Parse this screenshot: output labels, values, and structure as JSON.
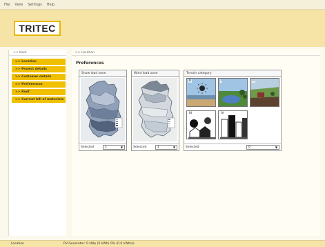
{
  "menu": {
    "items": [
      "File",
      "View",
      "Settings",
      "Help"
    ]
  },
  "brand": {
    "logo_text": "TRITEC",
    "accent": "#f0c000"
  },
  "sidebar": {
    "back_label": "<< back",
    "items": [
      {
        "label": ">> Location"
      },
      {
        "label": ">> Project details"
      },
      {
        "label": ">> Customer details"
      },
      {
        "label": ">> Preferences"
      },
      {
        "label": ">> Roof"
      },
      {
        "label": ">> Current bill of materials"
      }
    ]
  },
  "main": {
    "breadcrumb": ">> Location",
    "title": "Preferences",
    "snow": {
      "title": "Snow load zone",
      "select_label": "Selected",
      "value": "1"
    },
    "wind": {
      "title": "Wind load zone",
      "select_label": "Selected",
      "value": "1"
    },
    "terrain": {
      "title": "Terrain category",
      "select_label": "Selected",
      "value": "0",
      "tiles": [
        "0",
        "I",
        "II",
        "III",
        "IV"
      ]
    }
  },
  "status": {
    "left": "Location",
    "middle": "PV-Generator: 0 kWp (0 kWh) 0% (0.0 kWh/a)"
  }
}
